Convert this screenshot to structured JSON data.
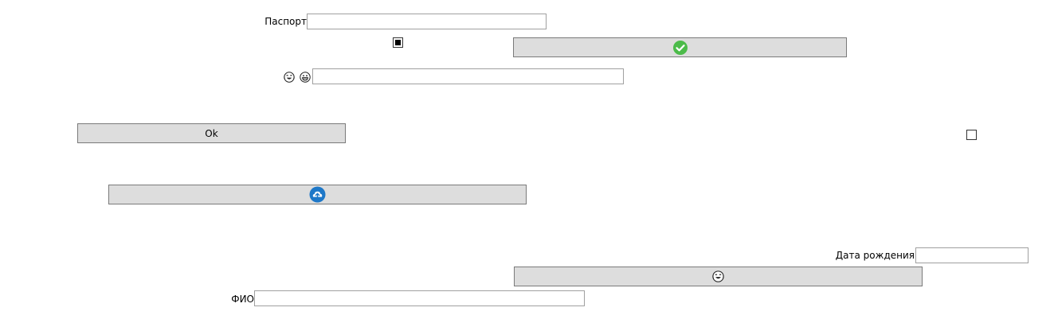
{
  "form": {
    "passport": {
      "label": "Паспорт",
      "value": "",
      "placeholder": ""
    },
    "checkbox_top": {
      "checked": true
    },
    "checkbox_right": {
      "checked": false
    },
    "emoji_field": {
      "value": "",
      "placeholder": ""
    },
    "ok_button": {
      "label": "Ok"
    },
    "birth_date": {
      "label": "Дата рождения",
      "value": "",
      "placeholder": ""
    },
    "fio": {
      "label": "ФИО",
      "value": "",
      "placeholder": ""
    }
  },
  "icons": {
    "check_button_icon": "check-circle-icon",
    "cloud_button_icon": "cloud-upload-icon",
    "emoji_button_icon": "tears-of-joy-emoji-icon",
    "label_emoji_1": "tears-of-joy-emoji-icon",
    "label_emoji_2": "grinning-emoji-icon"
  },
  "colors": {
    "button_bg": "#dddddd",
    "button_border": "#7a7a7a",
    "field_border": "#a0a0a0",
    "check_icon": "#4cbb4a",
    "cloud_icon": "#1e78c8"
  }
}
